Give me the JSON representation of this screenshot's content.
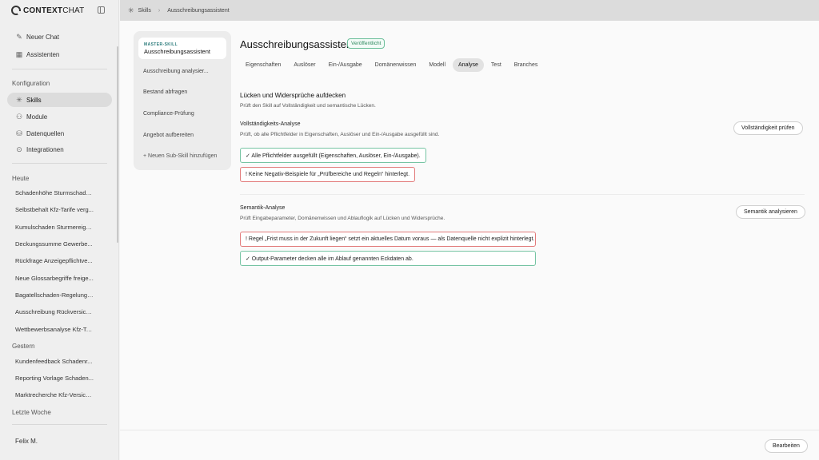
{
  "app": {
    "logo_text_bold": "CONTEXT",
    "logo_text_rest": "CHAT"
  },
  "sidebar": {
    "primary": [
      {
        "label": "Neuer Chat",
        "icon": "edit-icon"
      },
      {
        "label": "Assistenten",
        "icon": "grid-icon"
      }
    ],
    "config_label": "Konfiguration",
    "config": [
      {
        "label": "Skills",
        "icon": "sparkle-icon",
        "active": true
      },
      {
        "label": "Module",
        "icon": "module-icon"
      },
      {
        "label": "Datenquellen",
        "icon": "database-icon"
      },
      {
        "label": "Integrationen",
        "icon": "integration-icon"
      }
    ],
    "today_label": "Heute",
    "today": [
      "Schadenhöhe Sturmschade...",
      "Selbstbehalt Kfz-Tarife verg...",
      "Kumulschaden Sturmereign...",
      "Deckungssumme Gewerbe...",
      "Rückfrage Anzeigepflichtve...",
      "Neue Glossarbegriffe freige...",
      "Bagatellschaden-Regelung ...",
      "Ausschreibung Rückversich...",
      "Wettbewerbsanalyse Kfz-Ta..."
    ],
    "yesterday_label": "Gestern",
    "yesterday": [
      "Kundenfeedback Schadenr...",
      "Reporting Vorlage Schaden...",
      "Marktrecherche Kfz-Versich..."
    ],
    "lastweek_label": "Letzte Woche",
    "user": "Felix M."
  },
  "breadcrumb": {
    "root": "Skills",
    "current": "Ausschreibungsassistent"
  },
  "subskills": {
    "master_label": "MASTER-SKILL",
    "master_title": "Ausschreibungsassistent",
    "items": [
      "Ausschreibung analysier...",
      "Bestand abfragen",
      "Compliance-Prüfung",
      "Angebot aufbereiten"
    ],
    "add_label": "+ Neuen Sub-Skill hinzufügen"
  },
  "header": {
    "title": "Ausschreibungsassistent",
    "status": "Veröffentlicht"
  },
  "tabs": [
    {
      "label": "Eigenschaften"
    },
    {
      "label": "Auslöser"
    },
    {
      "label": "Ein-/Ausgabe"
    },
    {
      "label": "Domänenwissen"
    },
    {
      "label": "Modell"
    },
    {
      "label": "Analyse",
      "active": true
    },
    {
      "label": "Test"
    },
    {
      "label": "Branches"
    }
  ],
  "analysis": {
    "title": "Lücken und Widersprüche aufdecken",
    "desc": "Prüft den Skill auf Vollständigkeit und semantische Lücken.",
    "completeness": {
      "title": "Vollständigkeits-Analyse",
      "desc": "Prüft, ob alle Pflichtfelder in Eigenschaften, Auslöser und Ein-/Ausgabe ausgefüllt sind.",
      "button": "Vollständigkeit prüfen",
      "results": [
        {
          "status": "ok",
          "text": "✓ Alle Pflichtfelder ausgefüllt (Eigenschaften, Auslöser, Ein-/Ausgabe)."
        },
        {
          "status": "warn",
          "text": "! Keine Negativ-Beispiele für „Prüfbereiche und Regeln“ hinterlegt."
        }
      ]
    },
    "semantics": {
      "title": "Semantik-Analyse",
      "desc": "Prüft Eingabeparameter, Domänenwissen und Ablauflogik auf Lücken und Widersprüche.",
      "button": "Semantik analysieren",
      "results": [
        {
          "status": "warn",
          "text": "! Regel „Frist muss in der Zukunft liegen“ setzt ein aktuelles Datum voraus — als Datenquelle nicht explizit hinterlegt."
        },
        {
          "status": "ok",
          "text": "✓ Output-Parameter decken alle im Ablauf genannten Eckdaten ab."
        }
      ]
    }
  },
  "footer": {
    "edit_button": "Bearbeiten"
  },
  "colors": {
    "ok_border": "#76c4a3",
    "warn_border": "#e27b7b",
    "badge_text": "#2f8a5f",
    "master_label": "#2a7a7a"
  }
}
